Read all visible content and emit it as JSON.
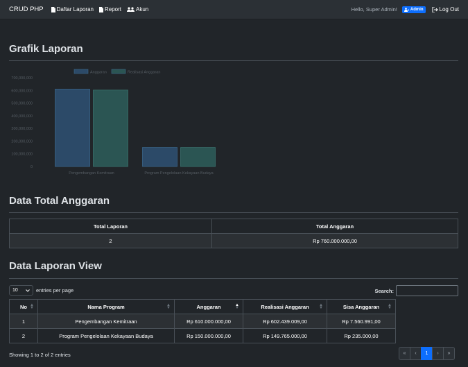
{
  "nav": {
    "brand": "CRUD PHP",
    "links": [
      "Daftar Laporan",
      "Report",
      "Akun"
    ],
    "hello": "Hello, Super Admin!",
    "badge": "Admin",
    "logout": "Log Out"
  },
  "sections": {
    "chart_title": "Grafik Laporan",
    "total_title": "Data Total Anggaran",
    "view_title": "Data Laporan View"
  },
  "chart_data": {
    "type": "bar",
    "categories": [
      "Pengembangan Kemitraan",
      "Program Pengelolaan Kekayaan Budaya"
    ],
    "series": [
      {
        "name": "Anggaran",
        "values": [
          610000000,
          150000000
        ],
        "color": "#2c4a68"
      },
      {
        "name": "Realisasi Anggaran",
        "values": [
          602439009,
          149765000
        ],
        "color": "#2b5553"
      }
    ],
    "yticks": [
      "0",
      "100,000,000",
      "200,000,000",
      "300,000,000",
      "400,000,000",
      "500,000,000",
      "600,000,000",
      "700,000,000"
    ],
    "ylim": [
      0,
      700000000
    ],
    "legend": "top"
  },
  "total_table": {
    "headers": [
      "Total Laporan",
      "Total Anggaran"
    ],
    "row": [
      "2",
      "Rp 760.000.000,00"
    ]
  },
  "controls": {
    "page_size": "10",
    "entries_label": "entries per page",
    "search_label": "Search:",
    "search_value": ""
  },
  "view_table": {
    "headers": [
      "No",
      "Nama Program",
      "Anggaran",
      "Realisasi Anggaran",
      "Sisa Anggaran"
    ],
    "rows": [
      [
        "1",
        "Pengembangan Kemitraan",
        "Rp 610.000.000,00",
        "Rp 602.439.009,00",
        "Rp 7.560.991,00"
      ],
      [
        "2",
        "Program Pengelolaan Kekayaan Budaya",
        "Rp 150.000.000,00",
        "Rp 149.765.000,00",
        "Rp 235.000,00"
      ]
    ]
  },
  "info": "Showing 1 to 2 of 2 entries",
  "pager": [
    "«",
    "‹",
    "1",
    "›",
    "»"
  ]
}
